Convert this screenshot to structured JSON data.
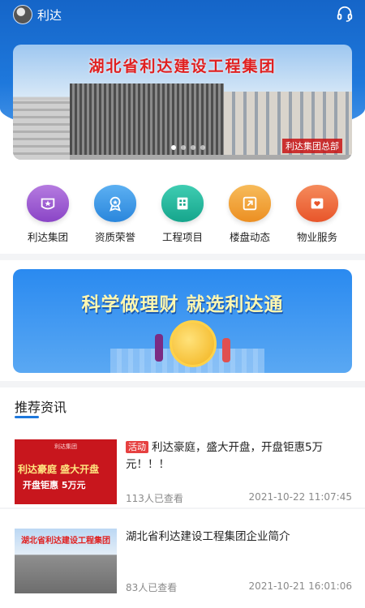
{
  "header": {
    "title": "利达"
  },
  "banner": {
    "title": "湖北省利达建设工程集团",
    "caption": "利达集团总部"
  },
  "menu": [
    {
      "label": "利达集团",
      "icon": "group-icon",
      "color": "#9b59d0"
    },
    {
      "label": "资质荣誉",
      "icon": "medal-icon",
      "color": "#2f8fe0"
    },
    {
      "label": "工程项目",
      "icon": "building-icon",
      "color": "#22b19a"
    },
    {
      "label": "楼盘动态",
      "icon": "news-icon",
      "color": "#f0a03a"
    },
    {
      "label": "物业服务",
      "icon": "heart-service-icon",
      "color": "#ef6a3a"
    }
  ],
  "promo": {
    "slogan": "科学做理财  就选利达通"
  },
  "section": {
    "title": "推荐资讯"
  },
  "news": [
    {
      "tag": "活动",
      "title": "利达豪庭，盛大开盘，开盘钜惠5万元！！！",
      "views": "113人已查看",
      "time": "2021-10-22 11:07:45",
      "thumb_text_a": "利达豪庭  盛大开盘",
      "thumb_text_b": "开盘钜惠 5万元",
      "thumb_logo": "利达集团"
    },
    {
      "title": "湖北省利达建设工程集团企业简介",
      "views": "83人已查看",
      "time": "2021-10-21 16:01:06",
      "thumb_text": "湖北省利达建设工程集团"
    }
  ]
}
